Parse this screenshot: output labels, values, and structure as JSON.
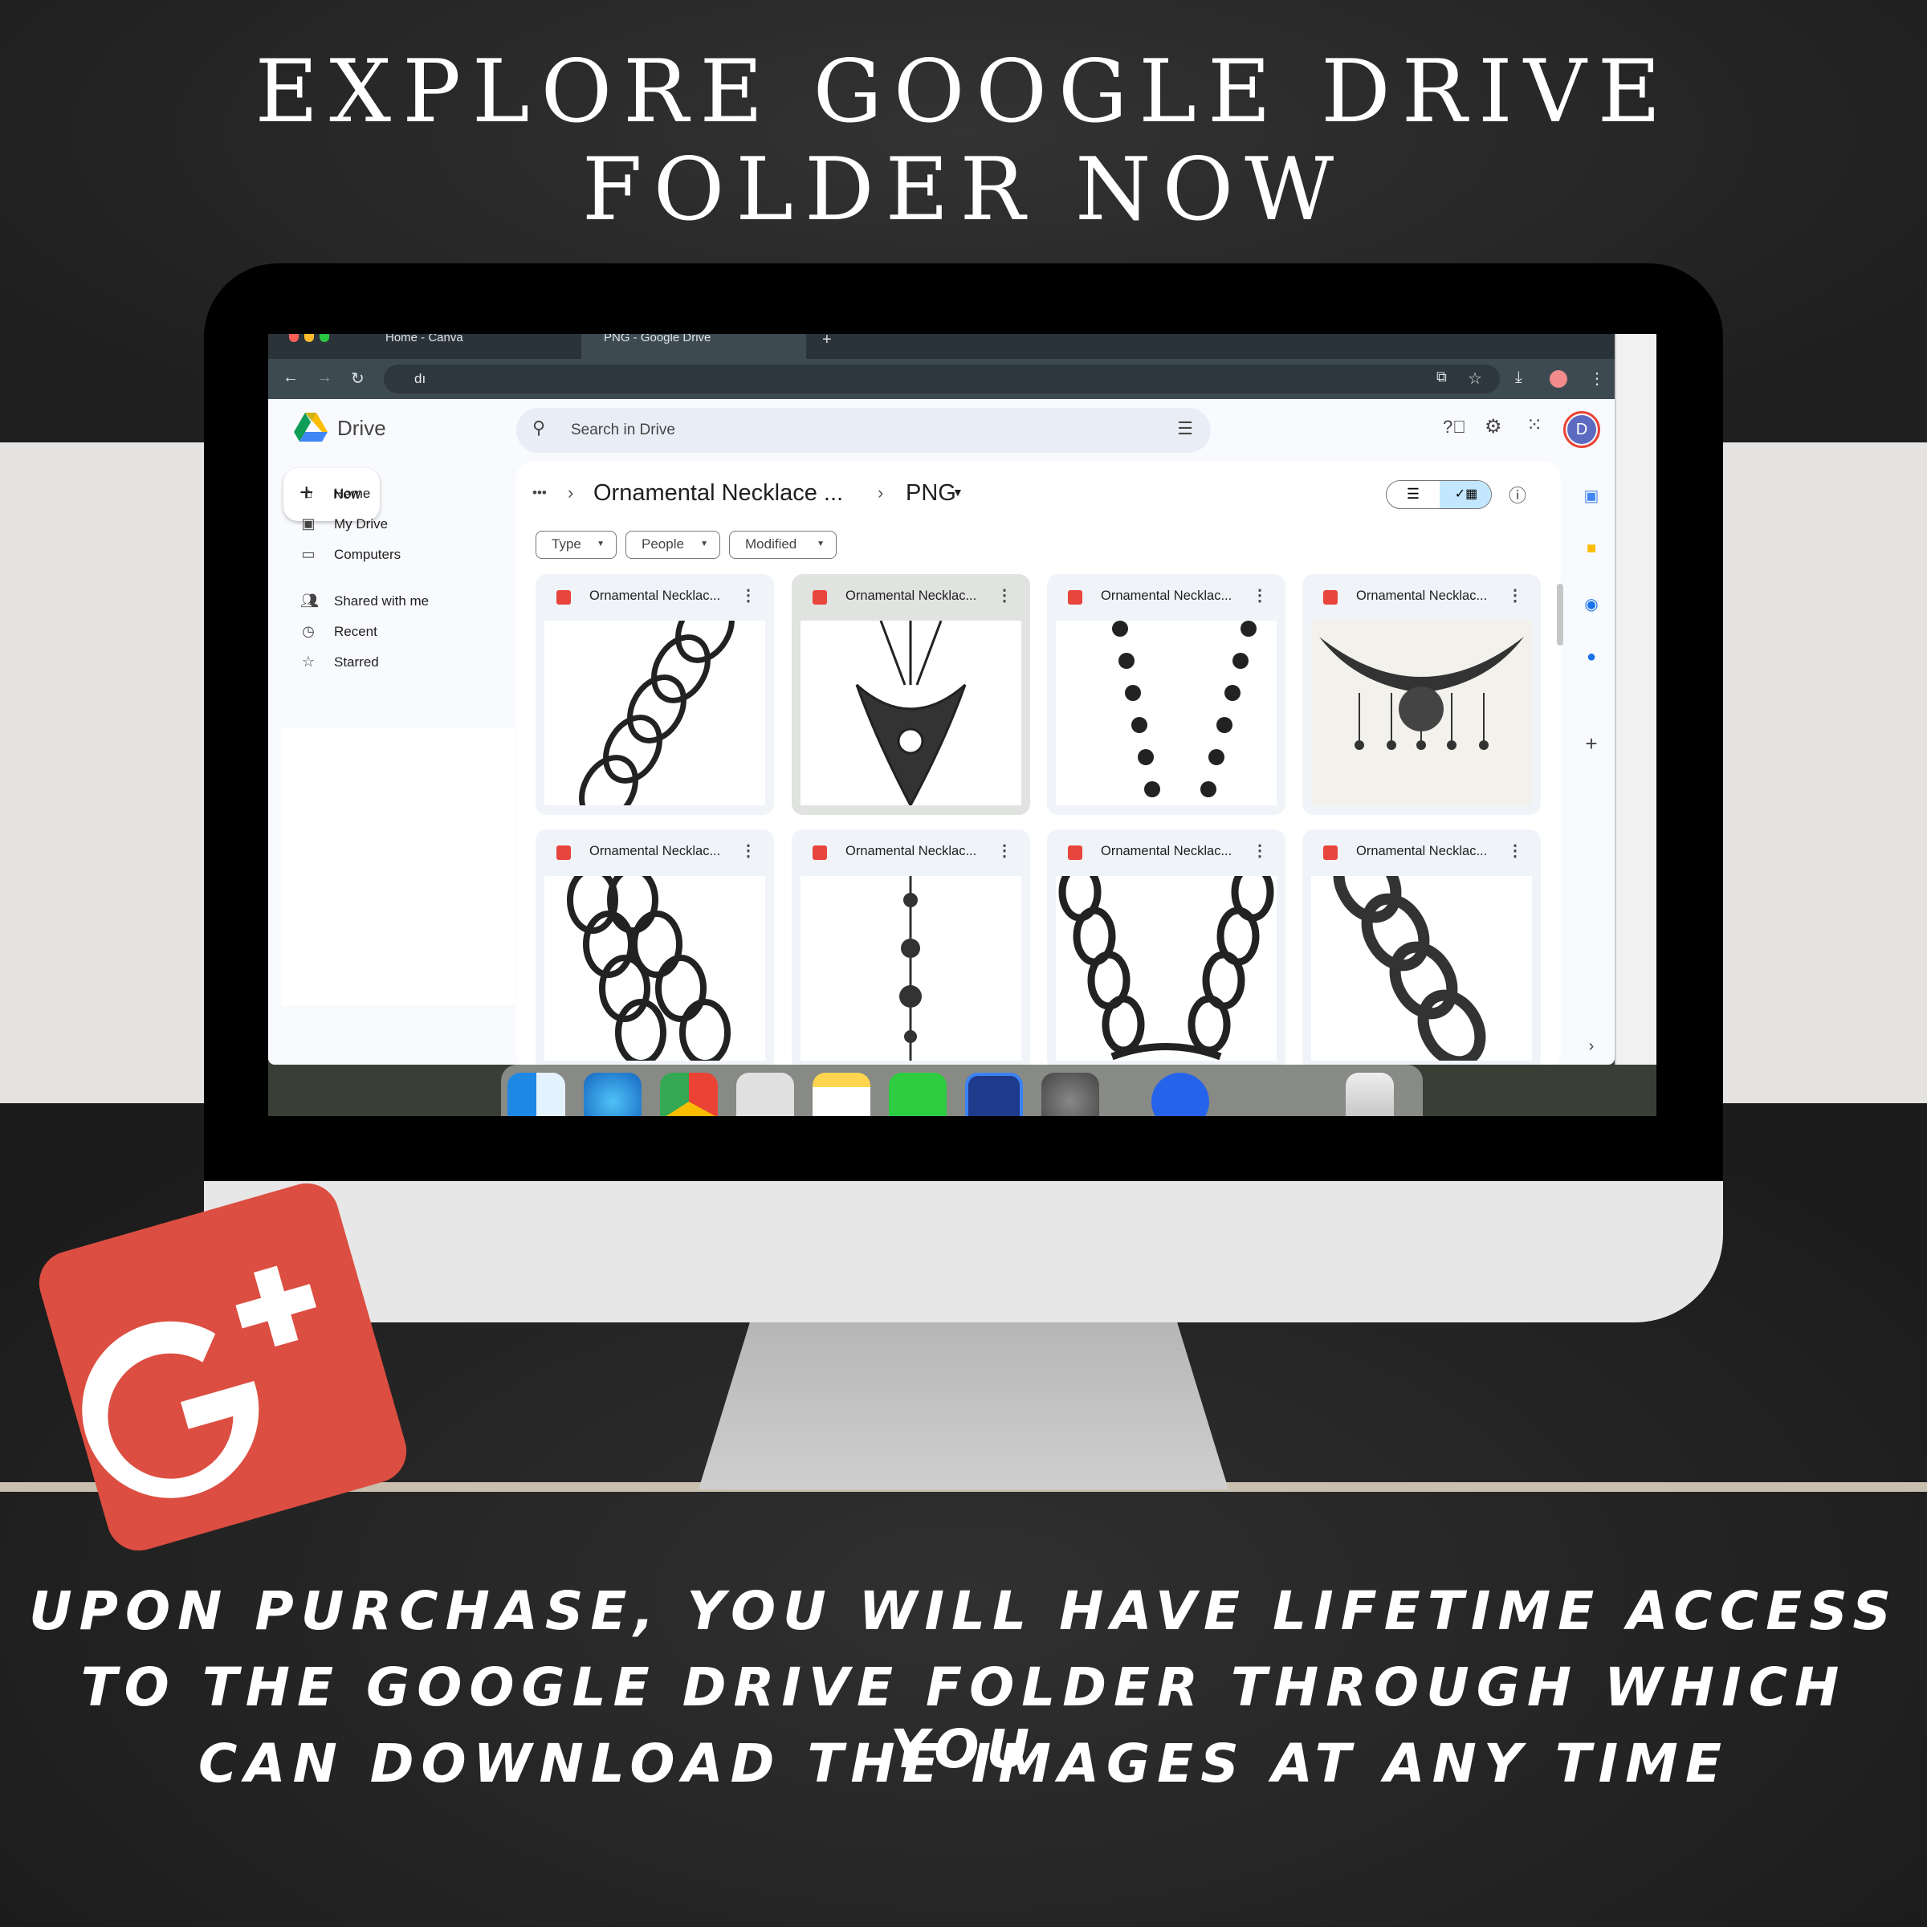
{
  "headline": {
    "line1": "EXPLORE GOOGLE DRIVE",
    "line2": "FOLDER NOW"
  },
  "caption": {
    "line1": "UPON PURCHASE, YOU WILL HAVE LIFETIME ACCESS",
    "line2": "TO THE GOOGLE DRIVE FOLDER THROUGH WHICH YOU",
    "line3": "CAN DOWNLOAD THE IMAGES AT ANY TIME"
  },
  "browser": {
    "tabs": [
      {
        "label": "Home - Canva"
      },
      {
        "label": "PNG - Google Drive"
      }
    ],
    "address": "dı"
  },
  "drive": {
    "app_name": "Drive",
    "search_placeholder": "Search in Drive",
    "avatar_letter": "D",
    "new_label": "New",
    "nav": [
      {
        "label": "Home",
        "icon": "home-icon"
      },
      {
        "label": "My Drive",
        "icon": "drive-icon"
      },
      {
        "label": "Computers",
        "icon": "computer-icon"
      },
      {
        "label": "Shared with me",
        "icon": "people-icon"
      },
      {
        "label": "Recent",
        "icon": "clock-icon"
      },
      {
        "label": "Starred",
        "icon": "star-icon"
      }
    ],
    "breadcrumb": {
      "more": "•••",
      "folder": "Ornamental Necklace ...",
      "current": "PNG"
    },
    "filters": [
      "Type",
      "People",
      "Modified"
    ],
    "files": [
      {
        "name": "Ornamental Necklac...",
        "art": "twisted-chain"
      },
      {
        "name": "Ornamental Necklac...",
        "art": "pendant"
      },
      {
        "name": "Ornamental Necklac...",
        "art": "bead-strand"
      },
      {
        "name": "Ornamental Necklac...",
        "art": "baroque-collar"
      },
      {
        "name": "Ornamental Necklac...",
        "art": "chain-links"
      },
      {
        "name": "Ornamental Necklac...",
        "art": "drop-pendant"
      },
      {
        "name": "Ornamental Necklac...",
        "art": "filigree-chain"
      },
      {
        "name": "Ornamental Necklac...",
        "art": "heavy-chain"
      }
    ]
  },
  "logo_text": "G+",
  "colors": {
    "gplus": "#dc4e41",
    "drive_blue": "#0b57d0",
    "file_icon": "#e8453c"
  }
}
